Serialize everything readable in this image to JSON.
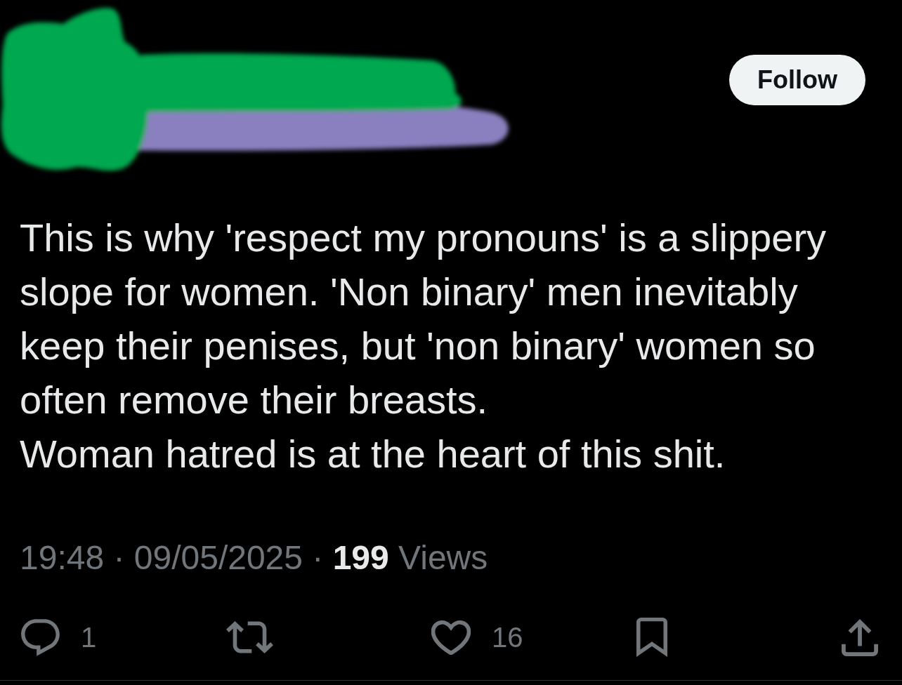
{
  "header": {
    "follow_button": "Follow"
  },
  "post": {
    "paragraphs": [
      "This is why 'respect my pronouns' is a slippery slope for women. 'Non binary' men inevitably keep their penises, but 'non binary' women so often remove their breasts.",
      "Woman hatred is at the heart of this shit."
    ]
  },
  "meta": {
    "line": "19:48 · 09/05/2025 · **199** Views"
  },
  "actions": [
    {
      "kind": "reply",
      "count": "1"
    },
    {
      "kind": "repost"
    },
    {
      "kind": "like",
      "count": "16"
    },
    {
      "kind": "bookmark"
    },
    {
      "kind": "share"
    }
  ]
}
